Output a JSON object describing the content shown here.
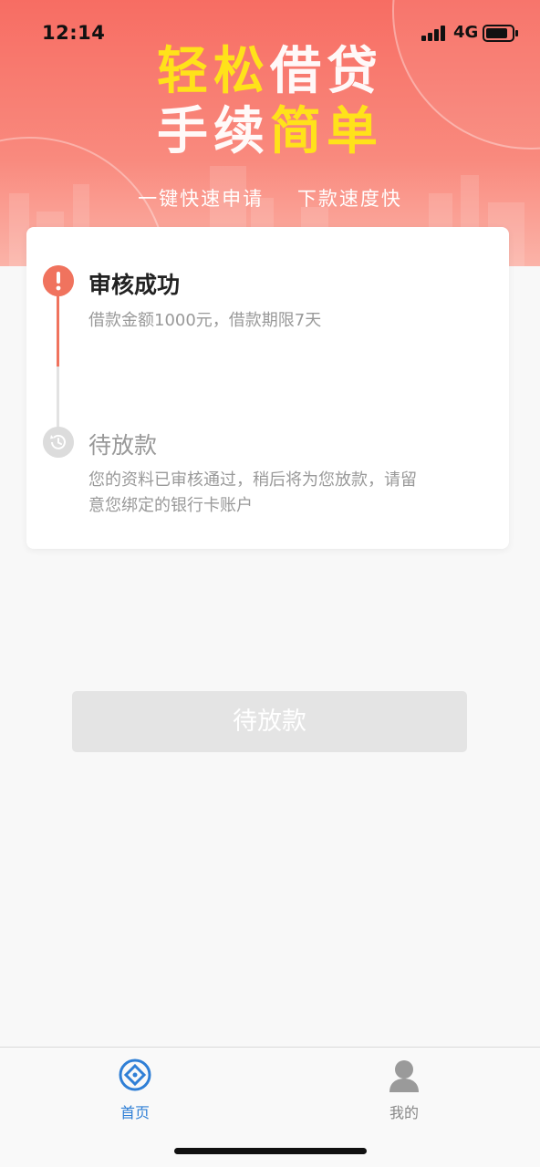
{
  "status_bar": {
    "time": "12:14",
    "network": "4G"
  },
  "banner": {
    "headline_line1_part1": "轻松",
    "headline_line1_part2": "借贷",
    "headline_line2_part1": "手续",
    "headline_line2_part2": "简单",
    "tagline_1": "一键快速申请",
    "tagline_2": "下款速度快"
  },
  "progress": {
    "steps": [
      {
        "title": "审核成功",
        "description": "借款金额1000元，借款期限7天",
        "state": "done"
      },
      {
        "title": "待放款",
        "description_line1": "您的资料已审核通过，稍后将为您放款，请留",
        "description_line2": "意您绑定的银行卡账户",
        "state": "waiting"
      }
    ]
  },
  "main_button": {
    "label": "待放款",
    "state": "disabled"
  },
  "tabbar": {
    "items": [
      {
        "label": "首页",
        "icon": "home-diamond-icon",
        "active": true
      },
      {
        "label": "我的",
        "icon": "user-profile-icon",
        "active": false
      }
    ]
  },
  "colors": {
    "accent": "#f0735e",
    "banner_top": "#f76d63",
    "headline_highlight": "#ffe21a",
    "tab_active": "#2f7fd6",
    "button_disabled": "#e4e4e4"
  }
}
